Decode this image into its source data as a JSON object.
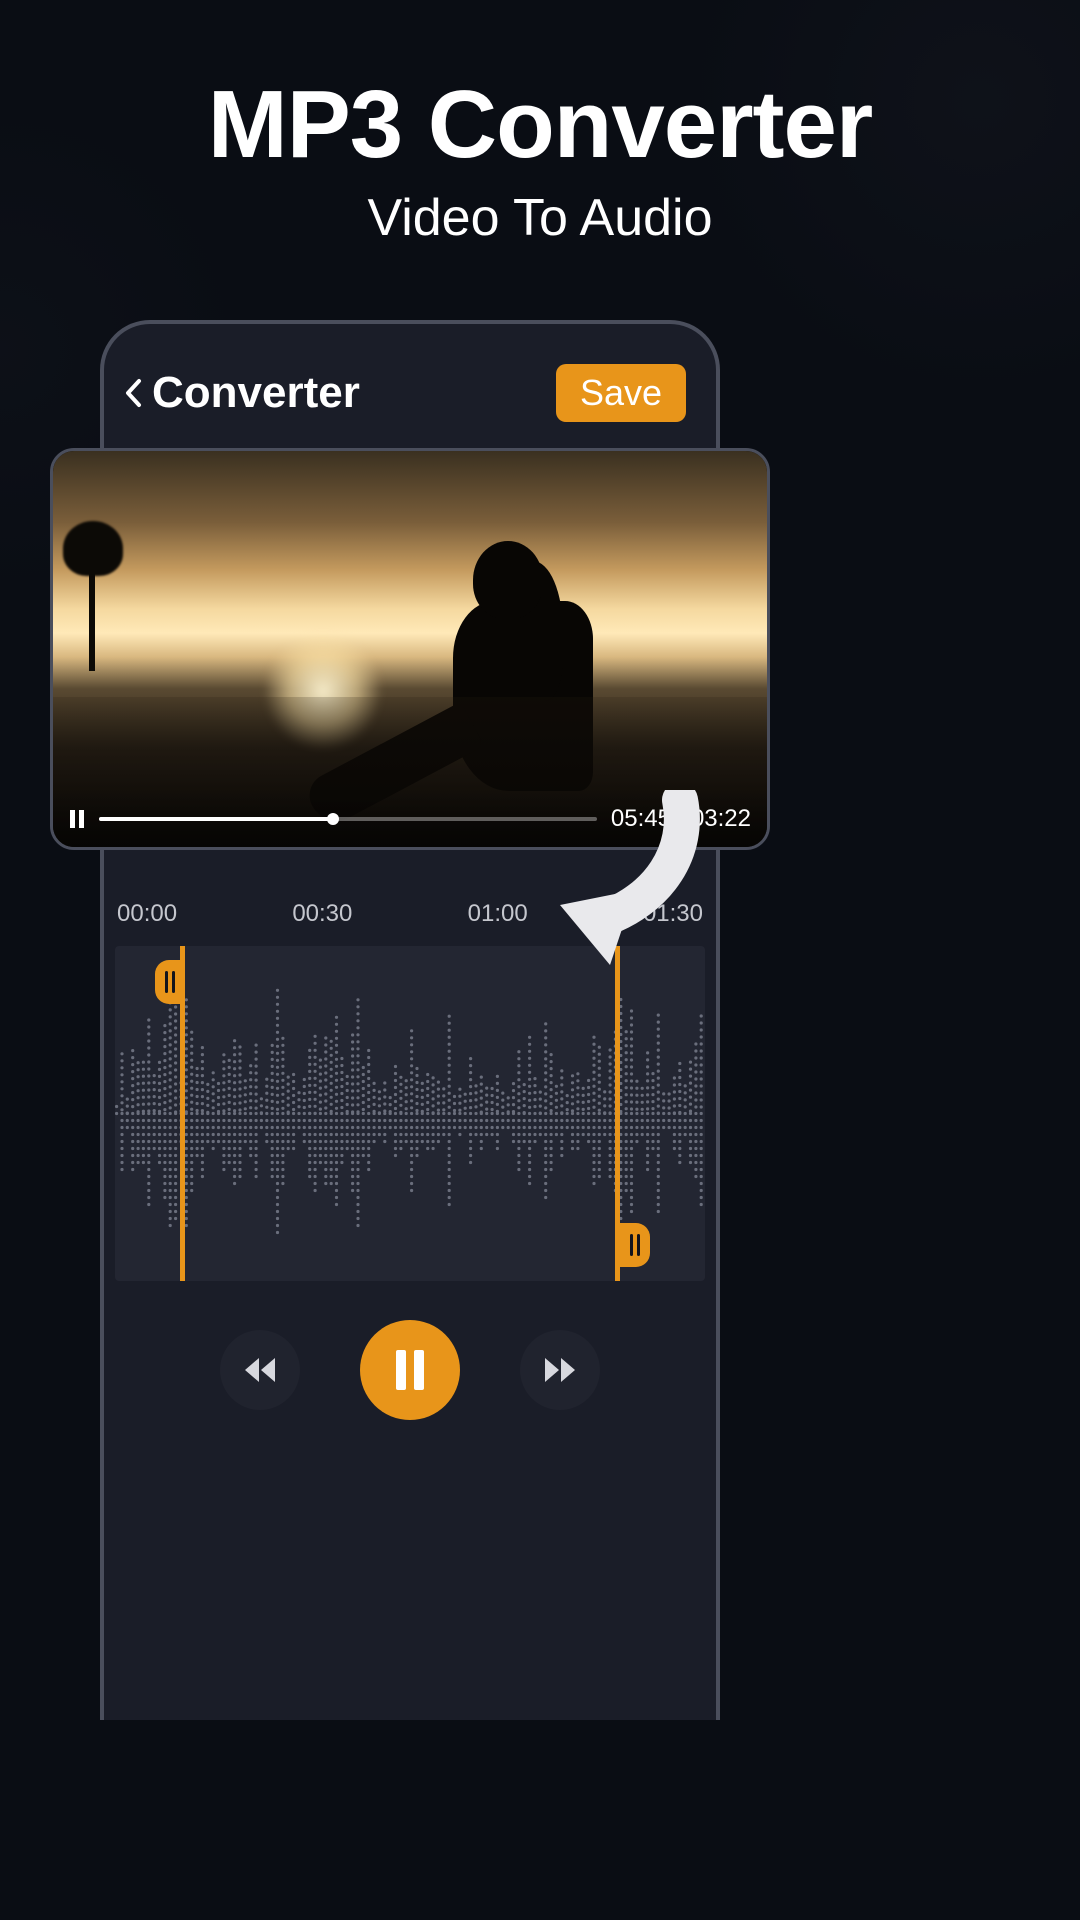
{
  "hero": {
    "title": "MP3 Converter",
    "subtitle": "Video To Audio"
  },
  "header": {
    "screen_title": "Converter",
    "save_label": "Save"
  },
  "video": {
    "time_label": "05:45 / 03:22",
    "progress_percent": 47
  },
  "timeline": {
    "ticks": [
      "00:00",
      "00:30",
      "01:00",
      "01:30"
    ]
  },
  "colors": {
    "accent": "#e8951a",
    "panel": "#1a1d28",
    "background": "#0a0d14"
  }
}
